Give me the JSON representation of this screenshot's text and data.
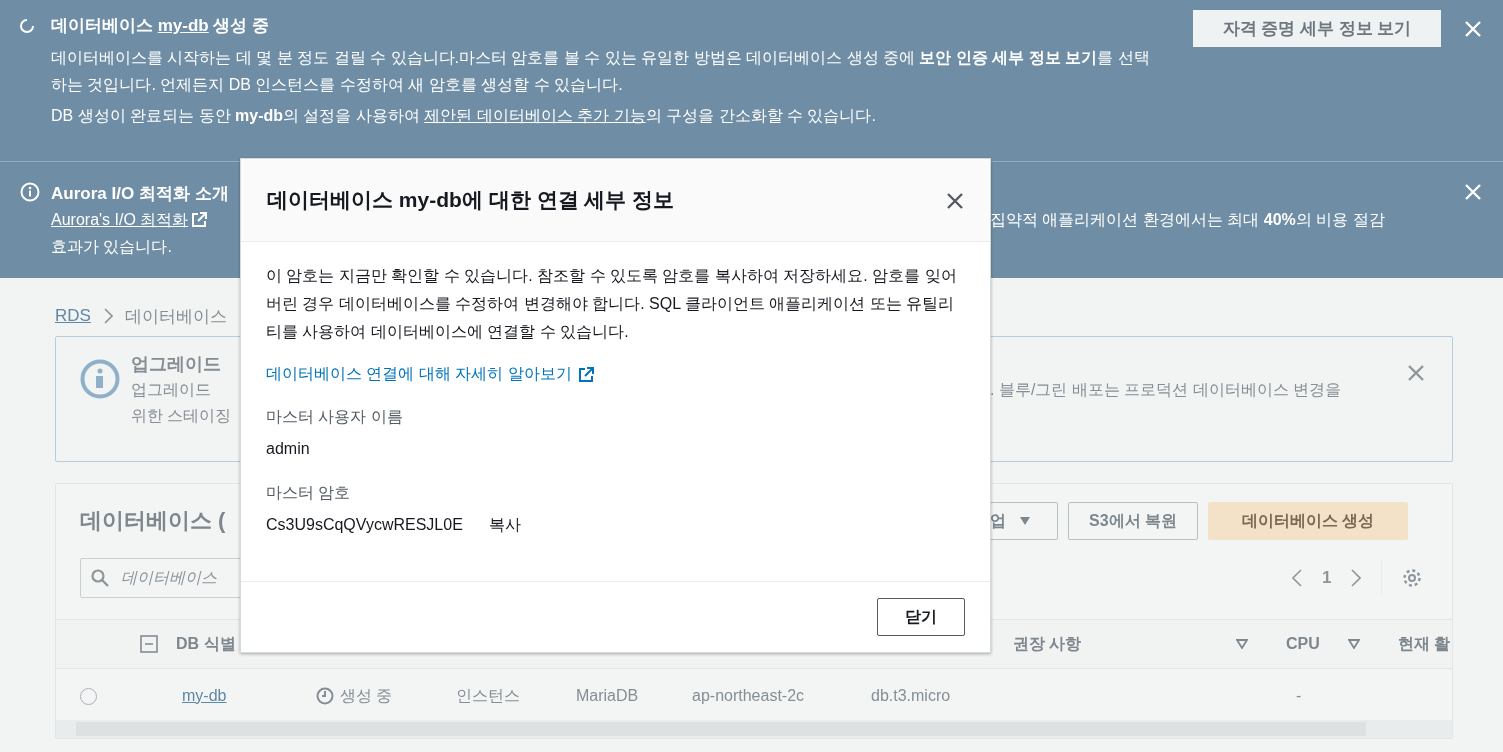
{
  "flash_creating": {
    "title_prefix": "데이터베이스",
    "title_link": "my-db",
    "title_suffix": "생성 중",
    "body": "데이터베이스를 시작하는 데 몇 분 정도 걸릴 수 있습니다.마스터 암호를 볼 수 있는 유일한 방법은 데이터베이스 생성 중에 **보안 인증 세부 정보 보기**를 선택하는 것입니다. 언제든지 DB 인스턴스를 수정하여 새 암호를 생성할 수 있습니다.",
    "note_before": "DB 생성이 완료되는 동안 **my-db**의 설정을 사용하여 ",
    "note_link": "제안된 데이터베이스 추가 기능",
    "note_after": "의 구성을 간소화할 수 있습니다.",
    "button": "자격 증명 세부 정보 보기"
  },
  "flash_aurora": {
    "title": "Aurora I/O 최적화 소개",
    "link": "Aurora's I/O 최적화",
    "right_text": "집약적 애플리케이션 환경에서는 최대 **40%**의 비용 절감",
    "last_line": "효과가 있습니다."
  },
  "breadcrumb": [
    {
      "label": "RDS",
      "kind": "link"
    },
    {
      "label": "데이터베이스",
      "kind": "current"
    }
  ],
  "upgrade_alert": {
    "title": "업그레이드",
    "line_1": "업그레이드",
    "line_2": "위한 스테이징",
    "right_text": ". 블루/그린 배포는 프로덕션 데이터베이스 변경을"
  },
  "databases": {
    "title": "데이터베이스 (",
    "actions_button": "업",
    "restore_button": "S3에서 복원",
    "create_button": "데이터베이스 생성",
    "search_placeholder": "데이터베이스",
    "page": "1"
  },
  "table": {
    "header_left": "DB 식별",
    "header_indeterminate": true,
    "header_right": [
      {
        "label": "권장 사항",
        "sortable": true
      },
      {
        "label": "CPU",
        "sortable": true
      },
      {
        "label": "현재 활",
        "sortable": false
      }
    ],
    "rows": [
      {
        "selected": false,
        "identifier": "my-db",
        "status": "생성 중",
        "role": "인스턴스",
        "engine": "MariaDB",
        "region": "ap-northeast-2c",
        "size": "db.t3.micro",
        "cpu": "-"
      }
    ]
  },
  "modal": {
    "title": "데이터베이스 my-db에 대한 연결 세부 정보",
    "description": "이 암호는 지금만 확인할 수 있습니다. 참조할 수 있도록 암호를 복사하여 저장하세요. 암호를 잊어버린 경우 데이터베이스를 수정하여 변경해야 합니다. SQL 클라이언트 애플리케이션 또는 유틸리티를 사용하여 데이터베이스에 연결할 수 있습니다.",
    "link": "데이터베이스 연결에 대해 자세히 알아보기",
    "fields": [
      {
        "label": "마스터 사용자 이름",
        "value": "admin"
      },
      {
        "label": "마스터 암호",
        "value": "Cs3U9sCqQVycwRESJL0E",
        "action": "복사"
      }
    ],
    "close_button": "닫기"
  }
}
